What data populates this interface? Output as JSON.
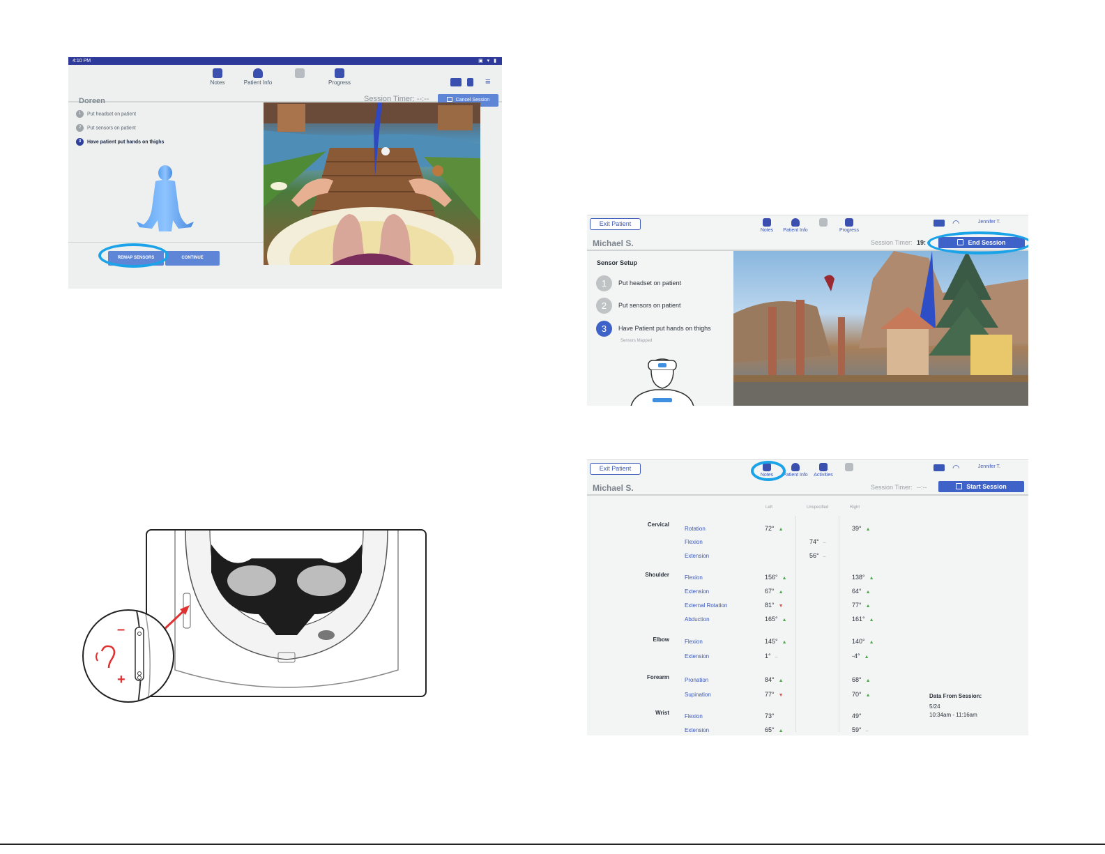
{
  "screen1": {
    "status_time": "4:10 PM",
    "nav": [
      {
        "label": "Notes",
        "icon": "notes-icon"
      },
      {
        "label": "Patient Info",
        "icon": "person-icon"
      },
      {
        "label": "",
        "icon": "activities-icon"
      },
      {
        "label": "Progress",
        "icon": "progress-icon"
      }
    ],
    "patient_name": "Doreen",
    "session_timer": "Session Timer:  --:--",
    "cancel_label": "Cancel Session",
    "steps": [
      {
        "num": "1",
        "label": "Put headset on patient"
      },
      {
        "num": "2",
        "label": "Put sensors on patient"
      },
      {
        "num": "3",
        "label": "Have patient put hands on thighs"
      }
    ],
    "remap_label": "REMAP SENSORS",
    "continue_label": "CONTINUE"
  },
  "screen2": {
    "exit_label": "Exit Patient",
    "nav": [
      {
        "label": "Notes",
        "icon": "notes-icon"
      },
      {
        "label": "Patient Info",
        "icon": "person-icon"
      },
      {
        "label": "",
        "icon": "activities-icon"
      },
      {
        "label": "Progress",
        "icon": "progress-icon"
      }
    ],
    "clinician": "Jennifer T.",
    "patient_name": "Michael S.",
    "session_timer": "Session Timer:",
    "timer_value": "19:",
    "end_label": "End Session",
    "sensor_setup_title": "Sensor Setup",
    "steps": [
      {
        "num": "1",
        "label": "Put headset on patient"
      },
      {
        "num": "2",
        "label": "Put sensors on patient"
      },
      {
        "num": "3",
        "label": "Have Patient put hands on thighs"
      }
    ],
    "sensors_mapped": "Sensors Mapped"
  },
  "screen3": {
    "exit_label": "Exit Patient",
    "nav": [
      {
        "label": "Notes",
        "icon": "notes-icon"
      },
      {
        "label": "Patient Info",
        "icon": "person-icon"
      },
      {
        "label": "Activities",
        "icon": "activities-icon"
      },
      {
        "label": "",
        "icon": "progress-icon"
      }
    ],
    "clinician": "Jennifer T.",
    "patient_name": "Michael S.",
    "session_timer": "Session Timer:",
    "timer_value": "--:--",
    "start_label": "Start Session",
    "columns": {
      "left": "Left",
      "unspecified": "Unspecified",
      "right": "Right"
    },
    "groups": [
      {
        "name": "Cervical",
        "rows": [
          {
            "movement": "Rotation",
            "left": "72°",
            "left_trend": "▲",
            "unspecified": "",
            "unspec_trend": "",
            "right": "39°",
            "right_trend": "▲"
          },
          {
            "movement": "Flexion",
            "left": "",
            "left_trend": "",
            "unspecified": "74°",
            "unspec_trend": "–",
            "right": "",
            "right_trend": ""
          },
          {
            "movement": "Extension",
            "left": "",
            "left_trend": "",
            "unspecified": "56°",
            "unspec_trend": "–",
            "right": "",
            "right_trend": ""
          }
        ]
      },
      {
        "name": "Shoulder",
        "rows": [
          {
            "movement": "Flexion",
            "left": "156°",
            "left_trend": "▲",
            "unspecified": "",
            "unspec_trend": "",
            "right": "138°",
            "right_trend": "▲"
          },
          {
            "movement": "Extension",
            "left": "67°",
            "left_trend": "▲",
            "unspecified": "",
            "unspec_trend": "",
            "right": "64°",
            "right_trend": "▲"
          },
          {
            "movement": "External Rotation",
            "left": "81°",
            "left_trend": "▼",
            "unspecified": "",
            "unspec_trend": "",
            "right": "77°",
            "right_trend": "▲"
          },
          {
            "movement": "Abduction",
            "left": "165°",
            "left_trend": "▲",
            "unspecified": "",
            "unspec_trend": "",
            "right": "161°",
            "right_trend": "▲"
          }
        ]
      },
      {
        "name": "Elbow",
        "rows": [
          {
            "movement": "Flexion",
            "left": "145°",
            "left_trend": "▲",
            "unspecified": "",
            "unspec_trend": "",
            "right": "140°",
            "right_trend": "▲"
          },
          {
            "movement": "Extension",
            "left": "1°",
            "left_trend": "–",
            "unspecified": "",
            "unspec_trend": "",
            "right": "-4°",
            "right_trend": "▲"
          }
        ]
      },
      {
        "name": "Forearm",
        "rows": [
          {
            "movement": "Pronation",
            "left": "84°",
            "left_trend": "▲",
            "unspecified": "",
            "unspec_trend": "",
            "right": "68°",
            "right_trend": "▲"
          },
          {
            "movement": "Supination",
            "left": "77°",
            "left_trend": "▼",
            "unspecified": "",
            "unspec_trend": "",
            "right": "70°",
            "right_trend": "▲"
          }
        ]
      },
      {
        "name": "Wrist",
        "rows": [
          {
            "movement": "Flexion",
            "left": "73°",
            "left_trend": "",
            "unspecified": "",
            "unspec_trend": "",
            "right": "49°",
            "right_trend": ""
          },
          {
            "movement": "Extension",
            "left": "65°",
            "left_trend": "▲",
            "unspecified": "",
            "unspec_trend": "",
            "right": "59°",
            "right_trend": "–"
          }
        ]
      }
    ],
    "data_from_session": {
      "title": "Data From Session:",
      "date": "5/24",
      "time": "10:34am - 11:16am"
    }
  },
  "headset": {
    "minus": "–",
    "plus": "+"
  },
  "colors": {
    "brand_blue": "#3f62c9",
    "highlight": "#1aa3e8",
    "alert_red": "#e03030"
  }
}
